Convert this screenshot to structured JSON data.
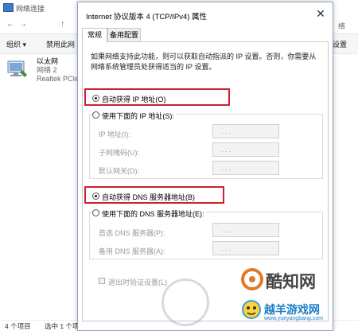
{
  "explorer": {
    "title": "网络连接",
    "nav_back": "←",
    "nav_forward": "→",
    "nav_up": "↑",
    "toolbar": {
      "organize": "组织 ▾",
      "disable": "禁用此网",
      "right_fragment": "设置"
    },
    "adapter": {
      "name": "以太网",
      "network": "网络 2",
      "device": "Realtek PCIe"
    },
    "status": {
      "items": "4 个项目",
      "selected": "选中 1 个项"
    }
  },
  "dialog": {
    "title": "Internet 协议版本 4 (TCP/IPv4) 属性",
    "close": "✕",
    "tabs": [
      "常规",
      "备用配置"
    ],
    "description": "如果网络支持此功能，则可以获取自动指派的 IP 设置。否则，你需要从网络系统管理员处获得适当的 IP 设置。",
    "ip": {
      "auto_label": "自动获得 IP 地址(O)",
      "manual_label": "使用下面的 IP 地址(S):",
      "fields": [
        "IP 地址(I):",
        "子网掩码(U):",
        "默认网关(D):"
      ],
      "auto_selected": true
    },
    "dns": {
      "auto_label": "自动获得 DNS 服务器地址(B)",
      "manual_label": "使用下面的 DNS 服务器地址(E):",
      "fields": [
        "首选 DNS 服务器(P):",
        "备用 DNS 服务器(A):"
      ],
      "auto_selected": true
    },
    "validate_label": "退出时验证设置(L)",
    "ip_dots": ".      .      ."
  },
  "watermark": {
    "top": "酷知网",
    "bottom": "越羊游戏网",
    "url": "www.yueyangbang.com"
  },
  "colors": {
    "highlight": "#d02030",
    "accent": "#3c7cc4"
  }
}
